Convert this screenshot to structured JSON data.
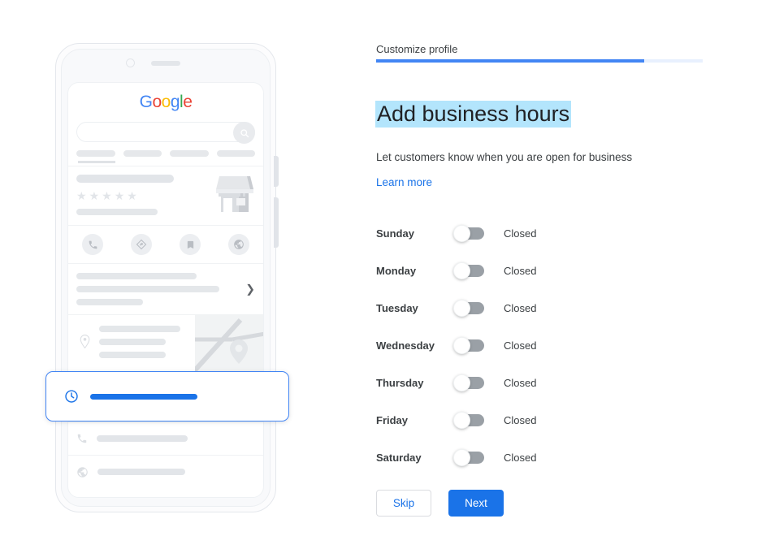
{
  "panel": {
    "step_label": "Customize profile",
    "progress_percent": 82,
    "title": "Add business hours",
    "subtitle": "Let customers know when you are open for business",
    "learn_more": "Learn more",
    "accent_color": "#4285F4",
    "link_color": "#1a73e8",
    "title_highlight_color": "#B3E5FC",
    "days": [
      {
        "name": "Sunday",
        "state": "Closed",
        "enabled": false
      },
      {
        "name": "Monday",
        "state": "Closed",
        "enabled": false
      },
      {
        "name": "Tuesday",
        "state": "Closed",
        "enabled": false
      },
      {
        "name": "Wednesday",
        "state": "Closed",
        "enabled": false
      },
      {
        "name": "Thursday",
        "state": "Closed",
        "enabled": false
      },
      {
        "name": "Friday",
        "state": "Closed",
        "enabled": false
      },
      {
        "name": "Saturday",
        "state": "Closed",
        "enabled": false
      }
    ],
    "buttons": {
      "skip": "Skip",
      "next": "Next"
    }
  },
  "phone_preview": {
    "logo": {
      "letters": [
        "G",
        "o",
        "o",
        "g",
        "l",
        "e"
      ],
      "colors": [
        "#4285F4",
        "#EA4335",
        "#FBBC05",
        "#4285F4",
        "#34A853",
        "#EA4335"
      ]
    },
    "search_icon": "search-icon",
    "chip_count": 4,
    "rating_stars": 5,
    "action_icons": [
      "phone-icon",
      "directions-icon",
      "bookmark-icon",
      "globe-icon"
    ],
    "highlight_card": {
      "icon": "clock-icon",
      "bar_color": "#1A73E8",
      "border_color": "#4285F4"
    },
    "bottom_rows": [
      "phone-icon",
      "globe-icon"
    ]
  }
}
